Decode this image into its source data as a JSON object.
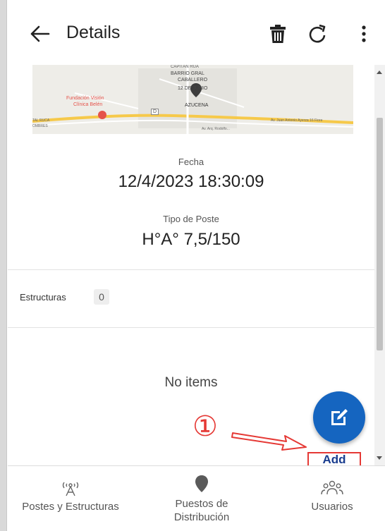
{
  "appbar": {
    "title": "Details",
    "back_icon": "arrow-left-icon",
    "delete_icon": "trash-icon",
    "refresh_icon": "refresh-icon",
    "more_icon": "more-vertical-icon"
  },
  "map": {
    "labels": {
      "capitan": "CAPITAN RUA",
      "barrio": "BARRIO GRAL",
      "caballero": "CABALLERO",
      "junio": "12 DE JUNIO",
      "azucena": "AZUCENA",
      "fundacion1": "Fundación Visión",
      "fundacion2": "Clínica Belén",
      "ruta_left": "TAL RUCA",
      "ruta_left2": "OMBRES",
      "road_right": "Av. Juan Antonio Ayerza 16 Fiore",
      "road_mid": "Av. Arq. Rodolfo...",
      "route_num": "D"
    }
  },
  "details": {
    "fecha_label": "Fecha",
    "fecha_value": "12/4/2023 18:30:09",
    "tipo_label": "Tipo de Poste",
    "tipo_value": "H°A° 7,5/150"
  },
  "estructuras": {
    "label": "Estructuras",
    "count": "0"
  },
  "list": {
    "empty_text": "No items"
  },
  "fab": {
    "icon": "edit-icon",
    "label": "Add"
  },
  "annotation": {
    "number": "①"
  },
  "bottomnav": {
    "items": [
      {
        "label": "Postes y Estructuras",
        "icon": "antenna-icon"
      },
      {
        "label": "Puestos de Distribución",
        "icon": "map-pin-icon"
      },
      {
        "label": "Usuarios",
        "icon": "users-icon"
      }
    ]
  },
  "colors": {
    "fab": "#1565c0",
    "annotation": "#e53935",
    "add_text": "#1a3d8f"
  }
}
